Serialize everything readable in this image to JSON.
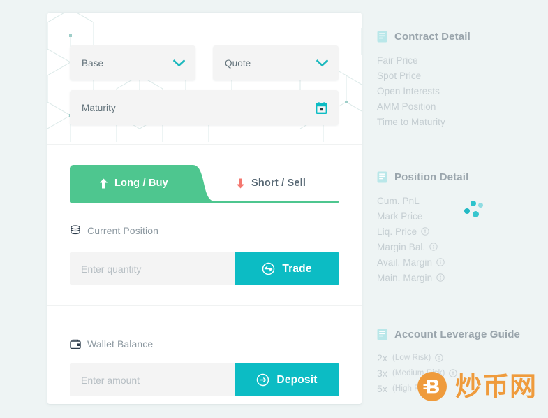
{
  "theme": {
    "page_bg": "#eef4f4",
    "card_bg": "#ffffff",
    "accent_teal": "#0cbcc4",
    "accent_green": "#4ec68f",
    "accent_red": "#f4776f",
    "muted_text": "#c5ced2",
    "watermark_orange": "#ef9b3c"
  },
  "contract_selector": {
    "base": {
      "placeholder": "Base",
      "value": "",
      "icon": "chevron-down-icon"
    },
    "quote": {
      "placeholder": "Quote",
      "value": "",
      "icon": "chevron-down-icon"
    },
    "maturity": {
      "placeholder": "Maturity",
      "value": "",
      "icon": "calendar-icon"
    }
  },
  "tabs": [
    {
      "label": "Long / Buy",
      "icon": "arrow-up-icon",
      "active": true
    },
    {
      "label": "Short / Sell",
      "icon": "arrow-down-icon",
      "active": false
    }
  ],
  "position_section": {
    "heading": "Current Position",
    "heading_icon": "database-icon",
    "input_placeholder": "Enter quantity",
    "input_value": "",
    "button_label": "Trade",
    "button_icon": "exchange-circle-icon"
  },
  "wallet_section": {
    "heading": "Wallet Balance",
    "heading_icon": "wallet-icon",
    "input_placeholder": "Enter amount",
    "input_value": "",
    "button_label": "Deposit",
    "button_icon": "arrow-right-circle-icon"
  },
  "sidebar": {
    "contract_detail": {
      "title": "Contract Detail",
      "icon": "document-list-icon",
      "rows": [
        {
          "label": "Fair Price",
          "info": false
        },
        {
          "label": "Spot Price",
          "info": false
        },
        {
          "label": "Open Interests",
          "info": false
        },
        {
          "label": "AMM Position",
          "info": false
        },
        {
          "label": "Time to Maturity",
          "info": false
        }
      ]
    },
    "position_detail": {
      "title": "Position Detail",
      "icon": "document-list-icon",
      "loading": true,
      "rows": [
        {
          "label": "Cum. PnL",
          "info": false
        },
        {
          "label": "Mark Price",
          "info": false
        },
        {
          "label": "Liq. Price",
          "info": true
        },
        {
          "label": "Margin Bal.",
          "info": true
        },
        {
          "label": "Avail. Margin",
          "info": true
        },
        {
          "label": "Main. Margin",
          "info": true
        }
      ]
    },
    "account_leverage_guide": {
      "title": "Account Leverage Guide",
      "icon": "document-list-icon",
      "rows": [
        {
          "multiplier": "2x",
          "note": "(Low Risk)",
          "info": true
        },
        {
          "multiplier": "3x",
          "note": "(Medium Risk)",
          "info": true
        },
        {
          "multiplier": "5x",
          "note": "(High Risk)",
          "info": true
        }
      ]
    }
  },
  "watermark": {
    "text": "炒币网",
    "icon": "bitcoin-b-icon"
  }
}
